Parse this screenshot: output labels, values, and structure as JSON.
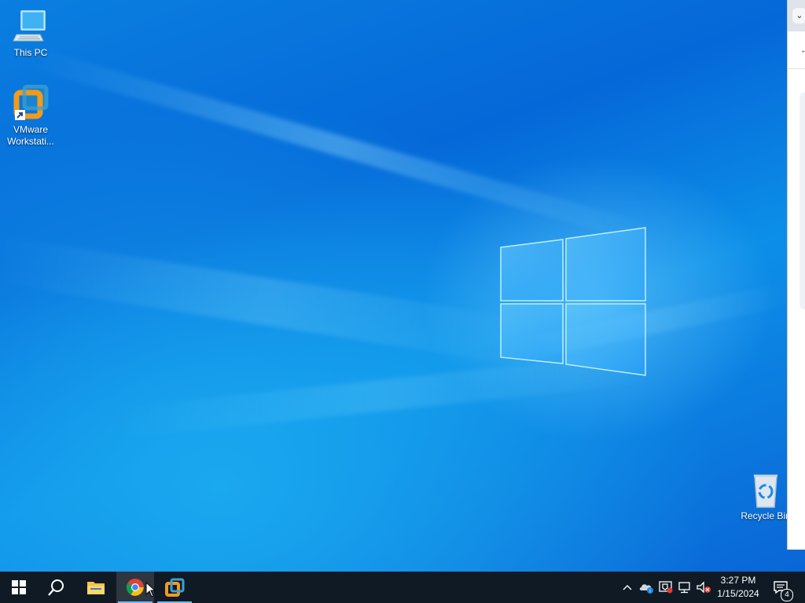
{
  "desktop": {
    "icons": [
      {
        "label": "This PC",
        "icon": "computer-icon"
      },
      {
        "label": "VMware Workstati...",
        "icon": "vmware-icon"
      },
      {
        "label": "Recycle Bin",
        "icon": "recycle-bin-icon"
      }
    ]
  },
  "side_window": {
    "dropdown_glyph": "⌄",
    "back_glyph": "←"
  },
  "taskbar": {
    "items": [
      {
        "name": "Start",
        "icon": "windows-start-icon"
      },
      {
        "name": "Search",
        "icon": "search-icon"
      },
      {
        "name": "File Explorer",
        "icon": "folder-icon"
      },
      {
        "name": "Google Chrome",
        "icon": "chrome-icon",
        "state": "active"
      },
      {
        "name": "VMware Workstation",
        "icon": "vmware-icon",
        "state": "running"
      }
    ],
    "tray": {
      "chevron": "^",
      "icons": [
        "onedrive-icon",
        "security-icon",
        "network-icon",
        "volume-muted-icon"
      ],
      "time": "3:27 PM",
      "date": "1/15/2024",
      "notification_count": "4"
    }
  },
  "colors": {
    "taskbar_bg": "#0f1a24",
    "accent": "#76b9ed",
    "desktop_blue": "#0a7fe0"
  }
}
